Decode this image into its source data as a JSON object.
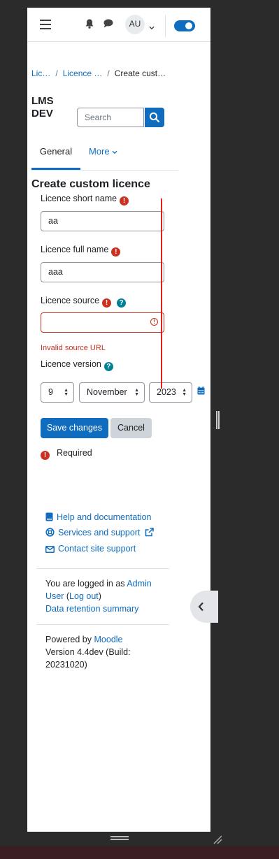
{
  "navbar": {
    "menu_icon": "hamburger-icon",
    "notifications_icon": "bell-icon",
    "messages_icon": "chat-icon",
    "avatar_initials": "AU",
    "edit_mode_toggle": "on"
  },
  "breadcrumb": [
    "Lic…",
    "Licence …",
    "Create cust…"
  ],
  "site_name": "LMS DEV",
  "search": {
    "placeholder": "Search"
  },
  "tabs": {
    "general": "General",
    "more": "More"
  },
  "heading": "Create custom licence",
  "form": {
    "short_name": {
      "label": "Licence short name",
      "value": "aa"
    },
    "full_name": {
      "label": "Licence full name",
      "value": "aaa"
    },
    "source": {
      "label": "Licence source",
      "value": "",
      "error": "Invalid source URL"
    },
    "version": {
      "label": "Licence version",
      "day": "9",
      "month": "November",
      "year": "2023"
    },
    "save_label": "Save changes",
    "cancel_label": "Cancel",
    "required_label": "Required"
  },
  "footer": {
    "help_link": "Help and documentation",
    "services_link": "Services and support",
    "contact_link": "Contact site support",
    "logged_in_prefix": "You are logged in as",
    "user_name": "Admin User",
    "logout_link": "Log out",
    "data_retention_link": "Data retention summary",
    "powered_by_prefix": "Powered by",
    "moodle_link": "Moodle",
    "version_text": "Version 4.4dev (Build: 20231020)"
  },
  "colors": {
    "primary": "#0f6cbf",
    "danger": "#ca3120",
    "info": "#008196",
    "annotation_line": "#e0201c"
  }
}
